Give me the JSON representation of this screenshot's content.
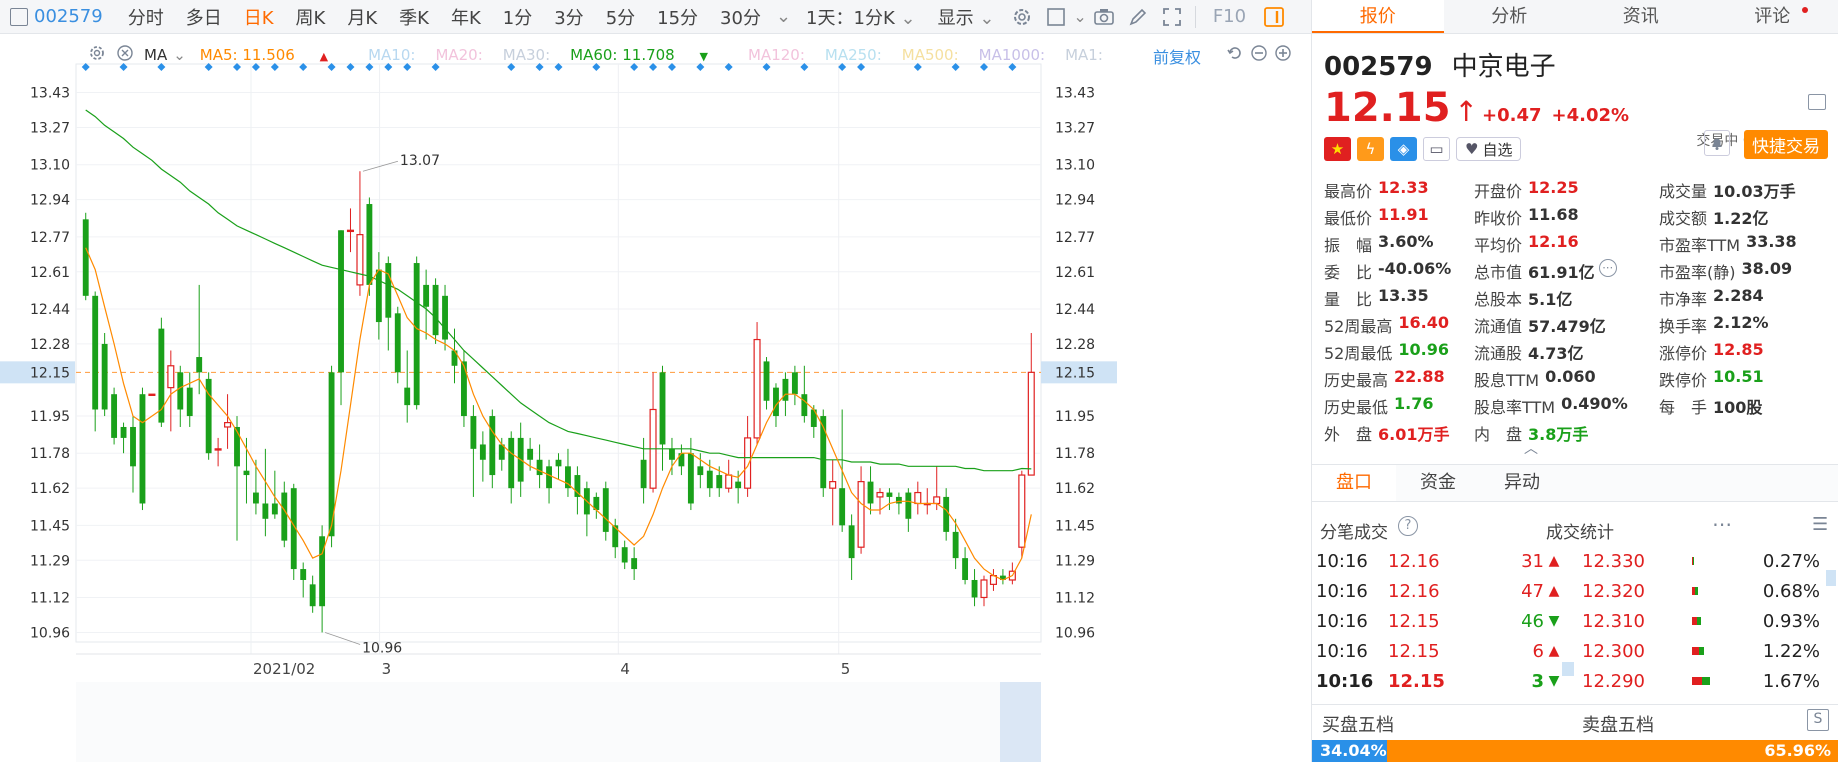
{
  "toolbar": {
    "stock_code": "002579",
    "periods": [
      "分时",
      "多日",
      "日K",
      "周K",
      "月K",
      "季K",
      "年K",
      "1分",
      "3分",
      "5分",
      "15分",
      "30分"
    ],
    "active_period": "日K",
    "interval_select": "1天：1分K",
    "display_label": "显示",
    "f10_label": "F10"
  },
  "ma_bar": {
    "label": "MA",
    "ma5": "MA5: 11.506",
    "ma10": "MA10:",
    "ma20": "MA20:",
    "ma30": "MA30:",
    "ma60": "MA60: 11.708",
    "ma120": "MA120:",
    "ma250": "MA250:",
    "ma500": "MA500:",
    "ma1000": "MA1000:",
    "ma1": "MA1:",
    "adjust": "前复权",
    "colors": {
      "ma5": "#ff8a00",
      "ma60": "#1aa01a",
      "faded": "#c7d0dc"
    }
  },
  "chart_data": {
    "type": "candlestick",
    "price_labels": [
      "13.43",
      "13.27",
      "13.10",
      "12.94",
      "12.77",
      "12.61",
      "12.44",
      "12.28",
      "12.15",
      "11.95",
      "11.78",
      "11.62",
      "11.45",
      "11.29",
      "11.12",
      "10.96"
    ],
    "price_ticks": [
      13.43,
      13.27,
      13.1,
      12.94,
      12.77,
      12.61,
      12.44,
      12.28,
      11.95,
      11.78,
      11.62,
      11.45,
      11.29,
      11.12,
      10.96
    ],
    "ylim": [
      10.93,
      13.46
    ],
    "current_price_line": 12.15,
    "current_price_label": "12.15",
    "high_label": "13.07",
    "low_label": "10.96",
    "x_labels": [
      {
        "label": "2021/02",
        "index": 9
      },
      {
        "label": "3",
        "index": 16
      },
      {
        "label": "4",
        "index": 29
      },
      {
        "label": "5",
        "index": 41
      }
    ],
    "candles": [
      [
        12.85,
        12.5,
        12.88,
        12.48
      ],
      [
        12.5,
        11.98,
        12.52,
        11.88
      ],
      [
        12.28,
        11.98,
        12.33,
        11.95
      ],
      [
        12.05,
        11.85,
        12.08,
        11.82
      ],
      [
        11.9,
        11.85,
        11.92,
        11.78
      ],
      [
        11.9,
        11.72,
        11.95,
        11.6
      ],
      [
        12.05,
        11.55,
        12.08,
        11.52
      ],
      [
        12.05,
        12.05,
        12.05,
        12.05
      ],
      [
        12.35,
        11.92,
        12.4,
        11.9
      ],
      [
        12.08,
        12.18,
        12.25,
        11.88
      ],
      [
        12.15,
        11.98,
        12.18,
        11.9
      ],
      [
        12.08,
        11.95,
        12.15,
        11.9
      ],
      [
        12.22,
        12.15,
        12.55,
        12.05
      ],
      [
        12.12,
        11.78,
        12.15,
        11.75
      ],
      [
        11.8,
        11.8,
        11.85,
        11.72
      ],
      [
        11.9,
        11.92,
        12.05,
        11.8
      ],
      [
        11.9,
        11.72,
        11.95,
        11.38
      ],
      [
        11.7,
        11.68,
        11.85,
        11.55
      ],
      [
        11.6,
        11.55,
        11.75,
        11.5
      ],
      [
        11.55,
        11.48,
        11.8,
        11.4
      ],
      [
        11.55,
        11.5,
        11.7,
        11.48
      ],
      [
        11.6,
        11.38,
        11.65,
        11.35
      ],
      [
        11.62,
        11.25,
        11.64,
        11.2
      ],
      [
        11.25,
        11.2,
        11.28,
        11.12
      ],
      [
        11.18,
        11.08,
        11.22,
        11.05
      ],
      [
        11.4,
        11.08,
        11.45,
        10.96
      ],
      [
        12.15,
        11.4,
        12.18,
        11.35
      ],
      [
        12.8,
        12.15,
        12.8,
        12.0
      ],
      [
        12.8,
        12.8,
        12.9,
        12.7
      ],
      [
        12.55,
        12.78,
        13.07,
        12.5
      ],
      [
        12.92,
        12.55,
        12.95,
        12.5
      ],
      [
        12.62,
        12.38,
        12.7,
        12.3
      ],
      [
        12.65,
        12.4,
        12.68,
        12.25
      ],
      [
        12.42,
        12.15,
        12.45,
        12.1
      ],
      [
        12.08,
        12.0,
        12.25,
        11.92
      ],
      [
        12.65,
        12.0,
        12.68,
        11.98
      ],
      [
        12.55,
        12.45,
        12.62,
        12.3
      ],
      [
        12.55,
        12.32,
        12.58,
        12.28
      ],
      [
        12.5,
        12.3,
        12.55,
        12.25
      ],
      [
        12.25,
        12.18,
        12.35,
        12.1
      ],
      [
        12.2,
        11.95,
        12.25,
        11.9
      ],
      [
        11.95,
        11.8,
        12.0,
        11.58
      ],
      [
        11.82,
        11.75,
        11.88,
        11.65
      ],
      [
        11.95,
        11.68,
        11.98,
        11.62
      ],
      [
        11.82,
        11.75,
        11.85,
        11.7
      ],
      [
        11.85,
        11.62,
        11.88,
        11.55
      ],
      [
        11.85,
        11.65,
        11.92,
        11.58
      ],
      [
        11.8,
        11.75,
        11.85,
        11.7
      ],
      [
        11.75,
        11.68,
        11.82,
        11.62
      ],
      [
        11.72,
        11.62,
        11.75,
        11.55
      ],
      [
        11.75,
        11.72,
        11.78,
        11.66
      ],
      [
        11.72,
        11.62,
        11.8,
        11.58
      ],
      [
        11.68,
        11.58,
        11.72,
        11.5
      ],
      [
        11.62,
        11.5,
        11.65,
        11.4
      ],
      [
        11.58,
        11.52,
        11.6,
        11.48
      ],
      [
        11.62,
        11.42,
        11.65,
        11.38
      ],
      [
        11.45,
        11.35,
        11.48,
        11.3
      ],
      [
        11.35,
        11.28,
        11.38,
        11.25
      ],
      [
        11.3,
        11.25,
        11.35,
        11.2
      ],
      [
        11.75,
        11.62,
        11.85,
        11.55
      ],
      [
        11.62,
        11.98,
        12.15,
        11.6
      ],
      [
        12.15,
        11.82,
        12.18,
        11.7
      ],
      [
        11.8,
        11.75,
        11.85,
        11.68
      ],
      [
        11.78,
        11.72,
        11.82,
        11.68
      ],
      [
        11.78,
        11.55,
        11.85,
        11.52
      ],
      [
        11.72,
        11.68,
        11.78,
        11.62
      ],
      [
        11.7,
        11.62,
        11.75,
        11.58
      ],
      [
        11.68,
        11.62,
        11.72,
        11.58
      ],
      [
        11.62,
        11.68,
        11.75,
        11.6
      ],
      [
        11.65,
        11.62,
        11.7,
        11.55
      ],
      [
        11.62,
        11.85,
        11.95,
        11.58
      ],
      [
        11.85,
        12.3,
        12.38,
        11.82
      ],
      [
        12.2,
        12.02,
        12.22,
        11.98
      ],
      [
        12.08,
        11.95,
        12.1,
        11.9
      ],
      [
        12.12,
        12.02,
        12.15,
        11.95
      ],
      [
        12.15,
        12.05,
        12.18,
        12.0
      ],
      [
        12.05,
        11.95,
        12.18,
        11.92
      ],
      [
        11.98,
        11.9,
        12.0,
        11.85
      ],
      [
        11.95,
        11.62,
        11.98,
        11.58
      ],
      [
        11.62,
        11.65,
        11.75,
        11.45
      ],
      [
        11.62,
        11.45,
        11.98,
        11.42
      ],
      [
        11.45,
        11.3,
        11.5,
        11.2
      ],
      [
        11.35,
        11.65,
        11.72,
        11.32
      ],
      [
        11.65,
        11.55,
        11.72,
        11.5
      ],
      [
        11.58,
        11.6,
        11.62,
        11.5
      ],
      [
        11.6,
        11.58,
        11.62,
        11.52
      ],
      [
        11.58,
        11.55,
        11.6,
        11.5
      ],
      [
        11.6,
        11.48,
        11.62,
        11.42
      ],
      [
        11.55,
        11.6,
        11.65,
        11.5
      ],
      [
        11.55,
        11.55,
        11.62,
        11.5
      ],
      [
        11.55,
        11.58,
        11.72,
        11.52
      ],
      [
        11.58,
        11.42,
        11.62,
        11.38
      ],
      [
        11.42,
        11.3,
        11.48,
        11.25
      ],
      [
        11.3,
        11.2,
        11.35,
        11.18
      ],
      [
        11.2,
        11.12,
        11.25,
        11.08
      ],
      [
        11.12,
        11.2,
        11.22,
        11.08
      ],
      [
        11.18,
        11.22,
        11.25,
        11.15
      ],
      [
        11.22,
        11.2,
        11.25,
        11.18
      ],
      [
        11.2,
        11.24,
        11.28,
        11.18
      ],
      [
        11.35,
        11.68,
        11.7,
        11.3
      ],
      [
        11.68,
        12.15,
        12.33,
        11.91
      ]
    ],
    "ma5": [
      12.72,
      12.62,
      12.45,
      12.28,
      12.1,
      11.95,
      11.92,
      11.95,
      11.98,
      12.05,
      12.08,
      12.1,
      12.12,
      12.05,
      12.0,
      11.95,
      11.88,
      11.8,
      11.72,
      11.65,
      11.58,
      11.52,
      11.45,
      11.38,
      11.3,
      11.32,
      11.45,
      11.7,
      12.0,
      12.3,
      12.55,
      12.62,
      12.6,
      12.5,
      12.4,
      12.35,
      12.33,
      12.3,
      12.28,
      12.25,
      12.18,
      12.05,
      11.95,
      11.88,
      11.82,
      11.78,
      11.75,
      11.72,
      11.7,
      11.68,
      11.66,
      11.64,
      11.6,
      11.56,
      11.52,
      11.48,
      11.44,
      11.4,
      11.36,
      11.4,
      11.5,
      11.62,
      11.72,
      11.78,
      11.78,
      11.75,
      11.72,
      11.7,
      11.68,
      11.67,
      11.72,
      11.82,
      11.92,
      12.0,
      12.05,
      12.05,
      12.02,
      11.98,
      11.9,
      11.8,
      11.7,
      11.6,
      11.55,
      11.52,
      11.52,
      11.55,
      11.56,
      11.56,
      11.55,
      11.55,
      11.55,
      11.52,
      11.46,
      11.38,
      11.3,
      11.25,
      11.22,
      11.2,
      11.22,
      11.3,
      11.5
    ],
    "ma60": [
      13.35,
      13.32,
      13.28,
      13.25,
      13.22,
      13.18,
      13.15,
      13.12,
      13.08,
      13.05,
      13.02,
      12.98,
      12.95,
      12.92,
      12.88,
      12.85,
      12.82,
      12.8,
      12.78,
      12.76,
      12.74,
      12.72,
      12.7,
      12.68,
      12.66,
      12.64,
      12.63,
      12.62,
      12.61,
      12.6,
      12.59,
      12.57,
      12.55,
      12.53,
      12.5,
      12.47,
      12.44,
      12.4,
      12.35,
      12.3,
      12.25,
      12.21,
      12.17,
      12.13,
      12.09,
      12.05,
      12.01,
      11.98,
      11.95,
      11.92,
      11.9,
      11.88,
      11.87,
      11.86,
      11.85,
      11.84,
      11.83,
      11.82,
      11.81,
      11.8,
      11.8,
      11.8,
      11.8,
      11.8,
      11.8,
      11.79,
      11.78,
      11.78,
      11.77,
      11.76,
      11.76,
      11.76,
      11.76,
      11.76,
      11.76,
      11.76,
      11.76,
      11.76,
      11.75,
      11.75,
      11.75,
      11.74,
      11.74,
      11.74,
      11.73,
      11.73,
      11.73,
      11.72,
      11.72,
      11.72,
      11.72,
      11.72,
      11.72,
      11.71,
      11.71,
      11.7,
      11.7,
      11.7,
      11.7,
      11.71,
      11.708
    ],
    "signals": [
      0,
      4,
      8,
      13,
      16,
      18,
      20,
      23,
      26,
      28,
      30,
      32,
      34,
      37,
      45,
      48,
      50,
      54,
      58,
      60,
      62,
      65,
      68,
      72,
      76,
      80,
      82,
      88,
      92,
      95,
      98
    ]
  },
  "panel": {
    "tabs": [
      "报价",
      "分析",
      "资讯",
      "评论"
    ],
    "active_tab": "报价",
    "stock_code": "002579",
    "stock_name": "中京电子",
    "price": "12.15",
    "change": "+0.47",
    "change_pct": "+4.02%",
    "trade_status": "交易中 05/28 10:16",
    "zixuan": "自选",
    "quick_trade": "快捷交易",
    "quote_rows": [
      [
        {
          "k": "最高价",
          "v": "12.33",
          "c": "red"
        },
        {
          "k": "开盘价",
          "v": "12.25",
          "c": "red"
        },
        {
          "k": "成交量",
          "v": "10.03万手",
          "c": "blk"
        }
      ],
      [
        {
          "k": "最低价",
          "v": "11.91",
          "c": "red"
        },
        {
          "k": "昨收价",
          "v": "11.68",
          "c": "blk"
        },
        {
          "k": "成交额",
          "v": "1.22亿",
          "c": "blk"
        }
      ],
      [
        {
          "k": "振　幅",
          "v": "3.60%",
          "c": "blk"
        },
        {
          "k": "平均价",
          "v": "12.16",
          "c": "red"
        },
        {
          "k": "市盈率TTM",
          "v": "33.38",
          "c": "blk"
        }
      ],
      [
        {
          "k": "委　比",
          "v": "-40.06%",
          "c": "blk"
        },
        {
          "k": "总市值",
          "v": "61.91亿",
          "c": "blk"
        },
        {
          "k": "市盈率(静)",
          "v": "38.09",
          "c": "blk"
        }
      ],
      [
        {
          "k": "量　比",
          "v": "13.35",
          "c": "blk"
        },
        {
          "k": "总股本",
          "v": "5.1亿",
          "c": "blk"
        },
        {
          "k": "市净率",
          "v": "2.284",
          "c": "blk"
        }
      ],
      [
        {
          "k": "52周最高",
          "v": "16.40",
          "c": "red"
        },
        {
          "k": "流通值",
          "v": "57.479亿",
          "c": "blk"
        },
        {
          "k": "换手率",
          "v": "2.12%",
          "c": "blk"
        }
      ],
      [
        {
          "k": "52周最低",
          "v": "10.96",
          "c": "green"
        },
        {
          "k": "流通股",
          "v": "4.73亿",
          "c": "blk"
        },
        {
          "k": "涨停价",
          "v": "12.85",
          "c": "red"
        }
      ],
      [
        {
          "k": "历史最高",
          "v": "22.88",
          "c": "red"
        },
        {
          "k": "股息TTM",
          "v": "0.060",
          "c": "blk"
        },
        {
          "k": "跌停价",
          "v": "10.51",
          "c": "green"
        }
      ],
      [
        {
          "k": "历史最低",
          "v": "1.76",
          "c": "green"
        },
        {
          "k": "股息率TTM",
          "v": "0.490%",
          "c": "blk"
        },
        {
          "k": "每　手",
          "v": "100股",
          "c": "blk"
        }
      ],
      [
        {
          "k": "外　盘",
          "v": "6.01万手",
          "c": "red"
        },
        {
          "k": "内　盘",
          "v": "3.8万手",
          "c": "green"
        },
        {
          "k": "",
          "v": "",
          "c": "blk"
        }
      ]
    ],
    "sub_tabs": [
      "盘口",
      "资金",
      "异动"
    ],
    "active_sub_tab": "盘口",
    "ticks_title": "分笔成交",
    "stats_title": "成交统计",
    "ticks": [
      {
        "t": "10:16",
        "p": "12.16",
        "n": "31",
        "d": "up"
      },
      {
        "t": "10:16",
        "p": "12.16",
        "n": "47",
        "d": "up"
      },
      {
        "t": "10:16",
        "p": "12.15",
        "n": "46",
        "d": "down"
      },
      {
        "t": "10:16",
        "p": "12.15",
        "n": "6",
        "d": "up"
      },
      {
        "t": "10:16",
        "p": "12.15",
        "n": "3",
        "d": "down"
      }
    ],
    "stats": [
      {
        "p": "12.330",
        "pct": "0.27%",
        "share": 0.03
      },
      {
        "p": "12.320",
        "pct": "0.68%",
        "share": 0.08
      },
      {
        "p": "12.310",
        "pct": "0.93%",
        "share": 0.11
      },
      {
        "p": "12.300",
        "pct": "1.22%",
        "share": 0.15
      },
      {
        "p": "12.290",
        "pct": "1.67%",
        "share": 0.22
      }
    ],
    "buy5_title": "买盘五档",
    "sell5_title": "卖盘五档",
    "buy_ratio": "34.04%",
    "sell_ratio": "65.96%"
  }
}
